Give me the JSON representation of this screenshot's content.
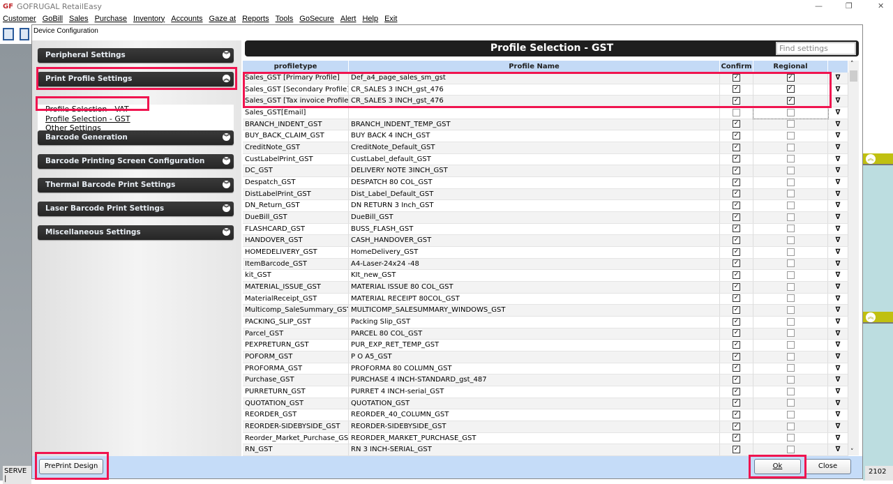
{
  "app": {
    "title": "GOFRUGAL RetailEasy",
    "logo": "GF",
    "window_controls": [
      "—",
      "❐",
      "✕"
    ]
  },
  "menu": [
    "Customer",
    "GoBill",
    "Sales",
    "Purchase",
    "Inventory",
    "Accounts",
    "Gaze at",
    "Reports",
    "Tools",
    "GoSecure",
    "Alert",
    "Help",
    "Exit"
  ],
  "status": {
    "left": "SERVE |",
    "right": "2102"
  },
  "dialog": {
    "title": "Device Configuration",
    "sections": [
      {
        "label": "Peripheral Settings",
        "expanded": false
      },
      {
        "label": "Print Profile Settings",
        "expanded": true
      },
      {
        "label": "Barcode Generation",
        "expanded": false
      },
      {
        "label": "Barcode Printing Screen Configuration",
        "expanded": false
      },
      {
        "label": "Thermal Barcode Print Settings",
        "expanded": false
      },
      {
        "label": "Laser Barcode Print Settings",
        "expanded": false
      },
      {
        "label": "Miscellaneous Settings",
        "expanded": false
      }
    ],
    "print_profile_items": [
      "Profile Selection - VAT",
      "Profile Selection - GST",
      "Other Settings"
    ],
    "selected_item": "Profile Selection - GST",
    "grid_title": "Profile Selection - GST",
    "search_placeholder": "Find settings",
    "columns": [
      "profiletype",
      "Profile Name",
      "Confirm",
      "Regional Language"
    ],
    "rows": [
      [
        "Sales_GST [Primary Profile]",
        "Def_a4_page_sales_sm_gst",
        true,
        true
      ],
      [
        "Sales_GST [Secondary Profile]",
        "CR_SALES 3 INCH_gst_476",
        true,
        true
      ],
      [
        "Sales_GST [Tax invoice Profile]",
        "CR_SALES 3 INCH_gst_476",
        true,
        true
      ],
      [
        "Sales_GST[Email]",
        "",
        false,
        false
      ],
      [
        "BRANCH_INDENT_GST",
        "BRANCH_INDENT_TEMP_GST",
        true,
        false
      ],
      [
        "BUY_BACK_CLAIM_GST",
        "BUY BACK 4 INCH_GST",
        true,
        false
      ],
      [
        "CreditNote_GST",
        "CreditNote_Default_GST",
        true,
        false
      ],
      [
        "CustLabelPrint_GST",
        "CustLabel_default_GST",
        true,
        false
      ],
      [
        "DC_GST",
        "DELIVERY NOTE 3INCH_GST",
        true,
        false
      ],
      [
        "Despatch_GST",
        "DESPATCH 80 COL_GST",
        true,
        false
      ],
      [
        "DistLabelPrint_GST",
        "Dist_Label_Default_GST",
        true,
        false
      ],
      [
        "DN_Return_GST",
        "DN RETURN 3 Inch_GST",
        true,
        false
      ],
      [
        "DueBill_GST",
        "DueBill_GST",
        true,
        false
      ],
      [
        "FLASHCARD_GST",
        "BUSS_FLASH_GST",
        true,
        false
      ],
      [
        "HANDOVER_GST",
        "CASH_HANDOVER_GST",
        true,
        false
      ],
      [
        "HOMEDELIVERY_GST",
        "HomeDelivery_GST",
        true,
        false
      ],
      [
        "ItemBarcode_GST",
        "A4-Laser-24x24 -48",
        true,
        false
      ],
      [
        "kit_GST",
        "KIt_new_GST",
        true,
        false
      ],
      [
        "MATERIAL_ISSUE_GST",
        "MATERIAL ISSUE 80 COL_GST",
        true,
        false
      ],
      [
        "MaterialReceipt_GST",
        "MATERIAL RECEIPT 80COL_GST",
        true,
        false
      ],
      [
        "Multicomp_SaleSummary_GST",
        "MULTICOMP_SALESUMMARY_WINDOWS_GST",
        true,
        false
      ],
      [
        "PACKING_SLIP_GST",
        "Packing Slip_GST",
        true,
        false
      ],
      [
        "Parcel_GST",
        "PARCEL 80 COL_GST",
        true,
        false
      ],
      [
        "PEXPRETURN_GST",
        "PUR_EXP_RET_TEMP_GST",
        true,
        false
      ],
      [
        "POFORM_GST",
        "P O A5_GST",
        true,
        false
      ],
      [
        "PROFORMA_GST",
        "PROFORMA  80 COLUMN_GST",
        true,
        false
      ],
      [
        "Purchase_GST",
        "PURCHASE 4 INCH-STANDARD_gst_487",
        true,
        false
      ],
      [
        "PURRETURN_GST",
        "PURRET 4 INCH-serial_GST",
        true,
        false
      ],
      [
        "QUOTATION_GST",
        "QUOTATION_GST",
        true,
        false
      ],
      [
        "REORDER_GST",
        "REORDER_40_COLUMN_GST",
        true,
        false
      ],
      [
        "REORDER-SIDEBYSIDE_GST",
        "REORDER-SIDEBYSIDE_GST",
        true,
        false
      ],
      [
        "Reorder_Market_Purchase_GST",
        "REORDER_MARKET_PURCHASE_GST",
        true,
        false
      ],
      [
        "RN_GST",
        "RN 3 INCH-SERIAL_GST",
        true,
        false
      ]
    ],
    "buttons": {
      "preprint": "PrePrint Design",
      "ok": "Ok",
      "close": "Close"
    },
    "highlight_color": "#f0144f"
  }
}
